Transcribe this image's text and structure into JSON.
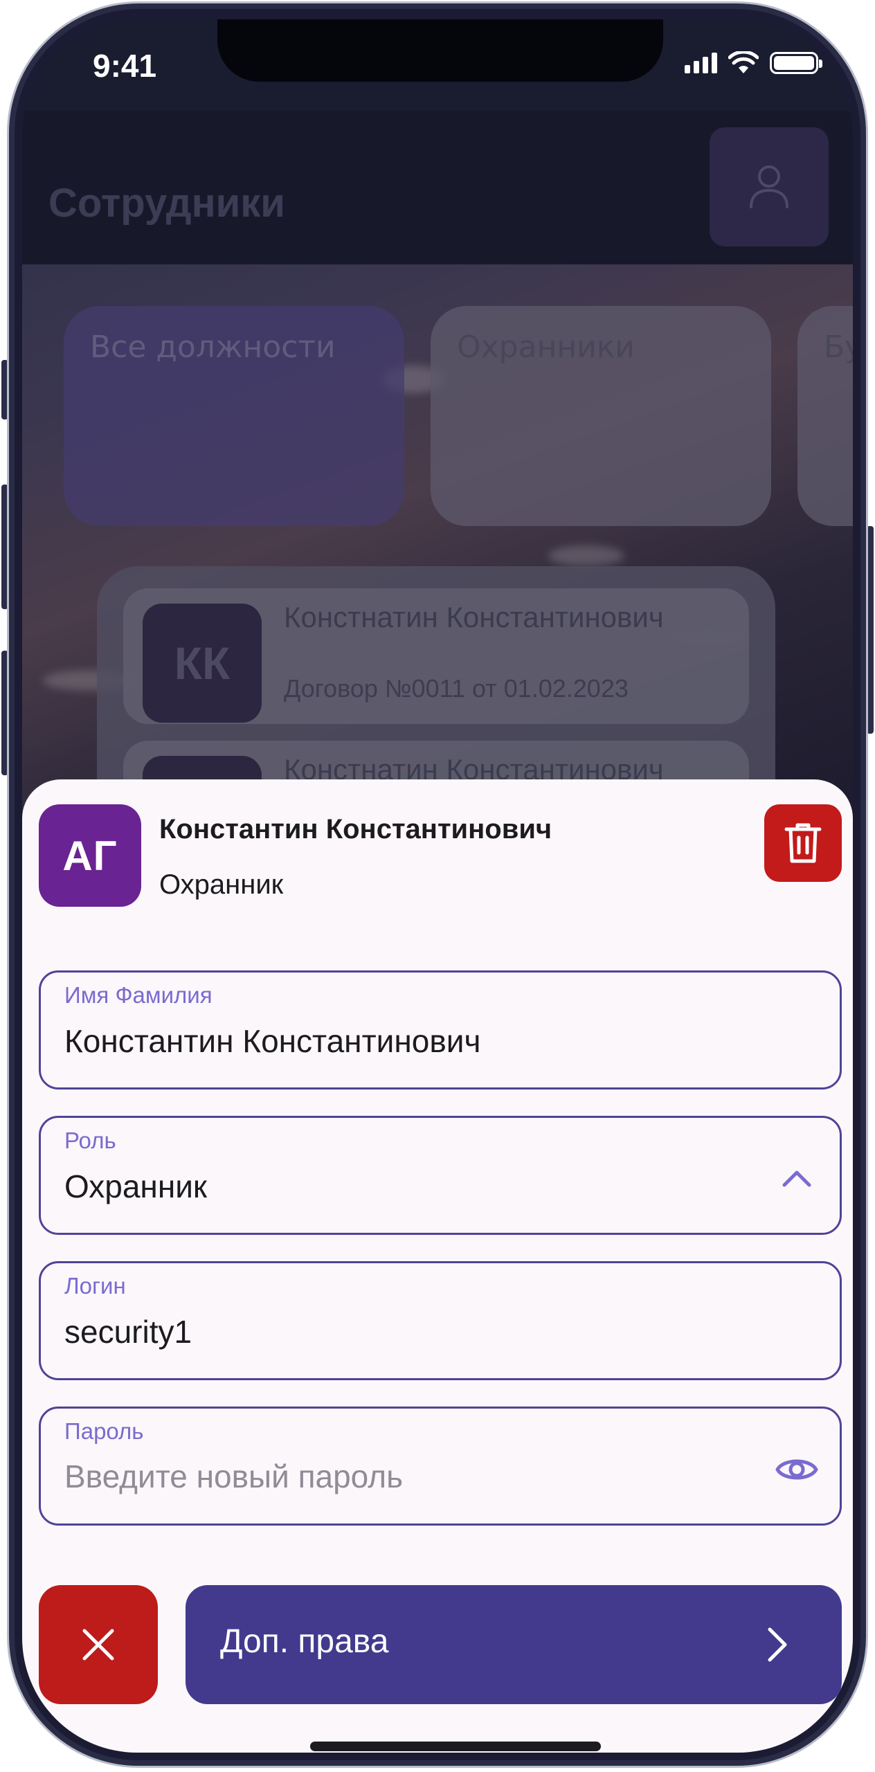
{
  "status_bar": {
    "time": "9:41"
  },
  "app": {
    "title": "Сотрудники",
    "filters": [
      "Все должности",
      "Охранники",
      "Бу"
    ],
    "employees": [
      {
        "initials": "КК",
        "name": "Констнатин Константинович",
        "contract": "Договор №0011 от 01.02.2023"
      },
      {
        "initials": "",
        "name": "Констнатин Константинович",
        "contract": ""
      }
    ]
  },
  "sheet": {
    "avatar_initials": "АГ",
    "name": "Константин Константинович",
    "role": "Охранник",
    "fields": {
      "name": {
        "label": "Имя Фамилия",
        "value": "Константин Константинович"
      },
      "role": {
        "label": "Роль",
        "value": "Охранник"
      },
      "login": {
        "label": "Логин",
        "value": "security1"
      },
      "password": {
        "label": "Пароль",
        "placeholder": "Введите новый пароль",
        "value": ""
      }
    },
    "permissions_button": "Доп. права"
  },
  "colors": {
    "accent": "#433a8e",
    "avatar": "#6a2393",
    "danger": "#c31a1a",
    "field_border": "#4f4396",
    "label": "#7a6bcf",
    "sheet_bg": "#fcf7fb"
  },
  "icons": {
    "profile": "person-icon",
    "delete": "trash-icon",
    "dropdown": "chevron-up-icon",
    "password_toggle": "eye-icon",
    "cancel": "close-icon",
    "next": "chevron-right-icon"
  }
}
